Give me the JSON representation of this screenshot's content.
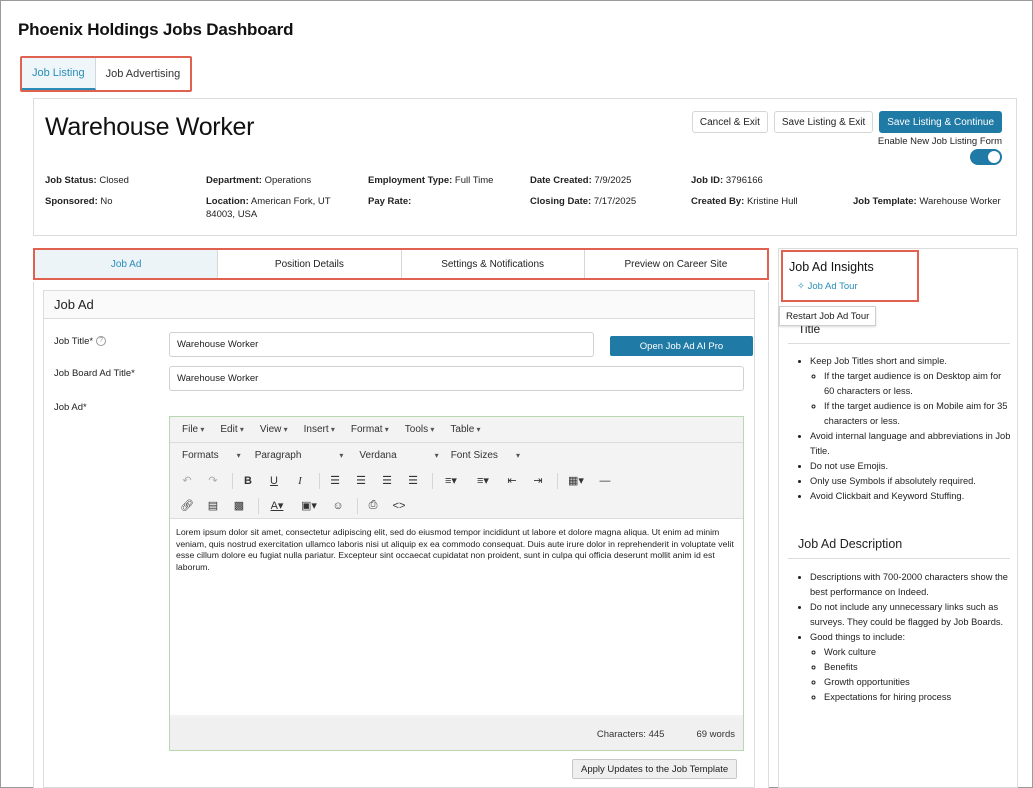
{
  "app_title": "Phoenix Holdings Jobs Dashboard",
  "top_tabs": [
    "Job Listing",
    "Job Advertising"
  ],
  "job": {
    "name": "Warehouse Worker",
    "buttons": {
      "cancel": "Cancel & Exit",
      "save_exit": "Save Listing & Exit",
      "save_continue": "Save Listing & Continue"
    },
    "toggle_label": "Enable New Job Listing Form",
    "meta": {
      "status_label": "Job Status:",
      "status": "Closed",
      "department_label": "Department:",
      "department": "Operations",
      "employment_label": "Employment Type:",
      "employment": "Full Time",
      "created_label": "Date Created:",
      "created": "7/9/2025",
      "id_label": "Job ID:",
      "id": "3796166",
      "sponsored_label": "Sponsored:",
      "sponsored": "No",
      "location_label": "Location:",
      "location_1": "American Fork, UT",
      "location_2": "84003, USA",
      "pay_label": "Pay Rate:",
      "closing_label": "Closing Date:",
      "closing": "7/17/2025",
      "created_by_label": "Created By:",
      "created_by": "Kristine Hull",
      "template_label": "Job Template:",
      "template": "Warehouse Worker"
    }
  },
  "sub_tabs": [
    "Job Ad",
    "Position Details",
    "Settings & Notifications",
    "Preview on Career Site"
  ],
  "jobad": {
    "heading": "Job Ad",
    "title_label": "Job Title*",
    "title_value": "Warehouse Worker",
    "ai_button": "Open Job Ad AI Pro",
    "board_label": "Job Board Ad Title*",
    "board_value": "Warehouse Worker",
    "ad_label": "Job Ad*",
    "menus": [
      "File",
      "Edit",
      "View",
      "Insert",
      "Format",
      "Tools",
      "Table"
    ],
    "selects": {
      "formats": "Formats",
      "paragraph": "Paragraph",
      "font": "Verdana",
      "sizes": "Font Sizes"
    },
    "body": "Lorem ipsum dolor sit amet, consectetur adipiscing elit, sed do eiusmod tempor incididunt ut labore et dolore magna aliqua. Ut enim ad minim veniam, quis nostrud exercitation ullamco laboris nisi ut aliquip ex ea commodo consequat. Duis aute irure dolor in reprehenderit in voluptate velit esse cillum dolore eu fugiat nulla pariatur. Excepteur sint occaecat cupidatat non proident, sunt in culpa qui officia deserunt mollit anim id est laborum.",
    "characters": "Characters: 445",
    "words": "69 words",
    "apply_button": "Apply Updates to the Job Template"
  },
  "insights": {
    "title": "Job Ad Insights",
    "tour_link": "Job Ad Tour",
    "tooltip": "Restart Job Ad Tour",
    "title_section": "Title",
    "title_tips": [
      "Keep Job Titles short and simple.",
      "If the target audience is on Desktop aim for 60 characters or less.",
      "If the target audience is on Mobile aim for 35 characters or less.",
      "Avoid internal language and abbreviations in Job Title.",
      "Do not use Emojis.",
      "Only use Symbols if absolutely required.",
      "Avoid Clickbait and Keyword Stuffing."
    ],
    "desc_section": "Job Ad Description",
    "desc_tips": [
      "Descriptions with 700-2000 characters show the best performance on Indeed.",
      "Do not include any unnecessary links such as surveys. They could be flagged by Job Boards.",
      "Good things to include:",
      "Work culture",
      "Benefits",
      "Growth opportunities",
      "Expectations for hiring process"
    ]
  }
}
